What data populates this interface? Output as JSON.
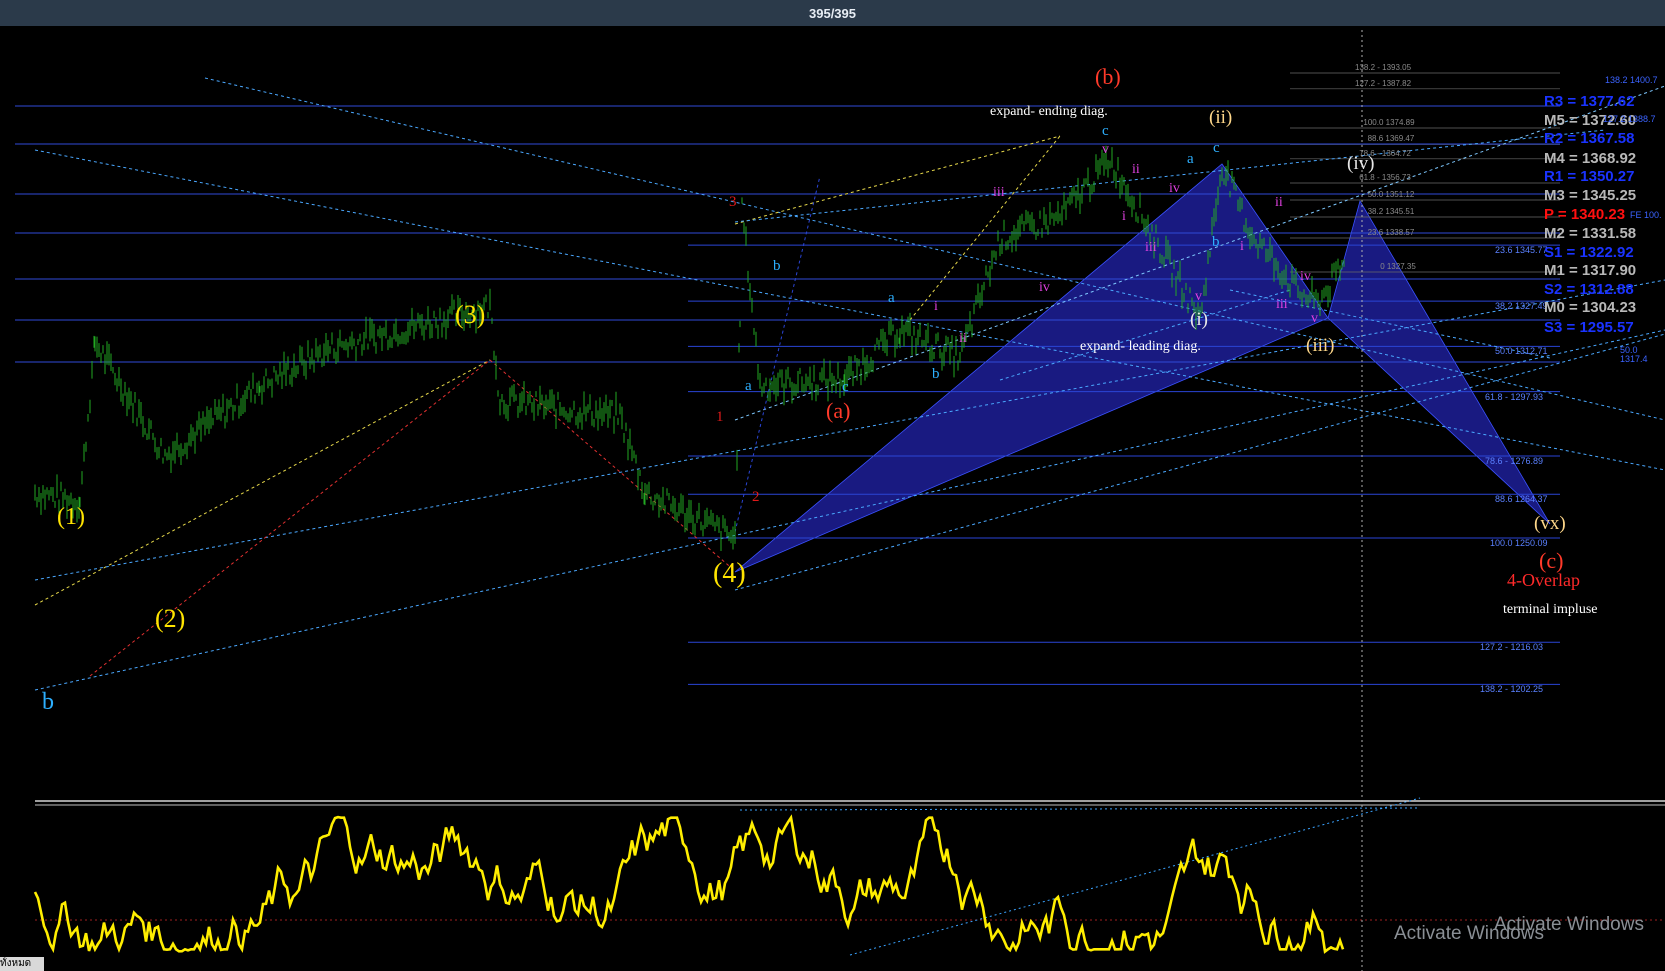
{
  "window": {
    "counter": "395/395"
  },
  "colors": {
    "background": "#000000",
    "price": "#21a121",
    "oscillator": "#ffee00",
    "fib_line": "#2b48d8",
    "harmonic": "#1a1a8c",
    "pivot_blue": "#1a33ff",
    "pivot_gray": "#b8b8b8",
    "pivot_red": "#ff1010"
  },
  "chart_data": {
    "type": "line",
    "symbol_counter": "395/395",
    "pivots": [
      {
        "name": "R3",
        "value": 1377.62,
        "color": "#1a33ff"
      },
      {
        "name": "M5",
        "value": 1372.6,
        "color": "#b8b8b8"
      },
      {
        "name": "R2",
        "value": 1367.58,
        "color": "#1a33ff"
      },
      {
        "name": "M4",
        "value": 1368.92,
        "color": "#b8b8b8"
      },
      {
        "name": "R1",
        "value": 1350.27,
        "color": "#1a33ff"
      },
      {
        "name": "M3",
        "value": 1345.25,
        "color": "#b8b8b8"
      },
      {
        "name": "P",
        "value": 1340.23,
        "color": "#ff1010"
      },
      {
        "name": "M2",
        "value": 1331.58,
        "color": "#b8b8b8"
      },
      {
        "name": "S1",
        "value": 1322.92,
        "color": "#1a33ff"
      },
      {
        "name": "M1",
        "value": 1317.9,
        "color": "#b8b8b8"
      },
      {
        "name": "S2",
        "value": 1312.88,
        "color": "#1a33ff"
      },
      {
        "name": "M0",
        "value": 1304.23,
        "color": "#b8b8b8"
      },
      {
        "name": "S3",
        "value": 1295.57,
        "color": "#1a33ff"
      }
    ],
    "pivot_labels": [
      "R3 = 1377.62",
      "M5 = 1372.60",
      "R2 = 1367.58",
      "M4 = 1368.92",
      "R1 = 1350.27",
      "M3 = 1345.25",
      "P   = 1340.23",
      "M2 = 1331.58",
      "S1 = 1322.92",
      "M1 = 1317.90",
      "S2 = 1312.88",
      "M0 = 1304.23",
      "S3 = 1295.57"
    ],
    "fib_retracement_upper": [
      {
        "level": "138.2",
        "price": 1393.05,
        "text": "138.2 - 1393.05"
      },
      {
        "level": "127.2",
        "price": 1387.82,
        "text": "127.2 - 1387.82"
      },
      {
        "level": "100.0",
        "price": 1374.89,
        "text": "100.0 1374.89"
      },
      {
        "level": "88.6",
        "price": 1369.47,
        "text": "88.6 1369.47"
      },
      {
        "level": "78.6",
        "price": 1364.72,
        "text": "78.6 - 1364.72"
      },
      {
        "level": "61.8",
        "price": 1356.73,
        "text": "61.8 - 1356.73"
      },
      {
        "level": "50.0",
        "price": 1351.12,
        "text": "50.0 1351.12"
      },
      {
        "level": "38.2",
        "price": 1345.51,
        "text": "38.2 1345.51"
      },
      {
        "level": "23.6",
        "price": 1338.57,
        "text": "23.6 1338.57"
      },
      {
        "level": "0",
        "price": 1327.35,
        "text": "0 1327.35"
      }
    ],
    "fib_retracement_main": [
      {
        "level": "23.6",
        "price": 1345.77,
        "text": "23.6 1345.77"
      },
      {
        "level": "38.2",
        "price": 1327.49,
        "text": "38.2 1327.49"
      },
      {
        "level": "50.0",
        "price": 1312.71,
        "text": "50.0 1312.71"
      },
      {
        "level": "61.8",
        "price": 1297.93,
        "text": "61.8 - 1297.93"
      },
      {
        "level": "78.6",
        "price": 1276.89,
        "text": "78.6 - 1276.89"
      },
      {
        "level": "88.6",
        "price": 1264.37,
        "text": "88.6 1264.37"
      },
      {
        "level": "100.0",
        "price": 1250.09,
        "text": "100.0 1250.09"
      },
      {
        "level": "127.2",
        "price": 1216.03,
        "text": "127.2 - 1216.03"
      },
      {
        "level": "138.2",
        "price": 1202.25,
        "text": "138.2 - 1202.25"
      }
    ],
    "fib_edge_text": [
      "138.2 1400.7",
      "127.2 1388.7",
      "FE 100.",
      "50.0 1317.4"
    ],
    "wave_labels": {
      "major": [
        "(1)",
        "(2)",
        "(3)",
        "(4)"
      ],
      "corrective": [
        "(a)",
        "(b)",
        "(c)"
      ],
      "minor": [
        "(i)",
        "(ii)",
        "(iii)",
        "(iv)",
        "(vx)"
      ],
      "small_counts": [
        "1",
        "2",
        "3",
        "a",
        "b",
        "c",
        "i",
        "ii",
        "iii",
        "iv",
        "v"
      ],
      "start_label": "b"
    },
    "annotations": [
      "expand- ending diag.",
      "expand- leading diag.",
      "4-Overlap",
      "terminal impluse"
    ],
    "price_series_summary": {
      "start": 1265,
      "wave1_high": 1314,
      "wave2_low": 1277,
      "wave3_high": 1326,
      "wave4_low": 1250,
      "wave_a_low": 1302,
      "wave_b_high": 1374,
      "wave_ii_high": 1372,
      "wave_iii_low": 1327,
      "last": 1340
    },
    "oscillator": {
      "range": [
        0,
        100
      ],
      "midline": 50
    }
  },
  "footer": {
    "sheet_tab": "ทั้งหมด"
  },
  "watermark": {
    "line1": "Activate Windows",
    "line2": "Activate Windows"
  }
}
